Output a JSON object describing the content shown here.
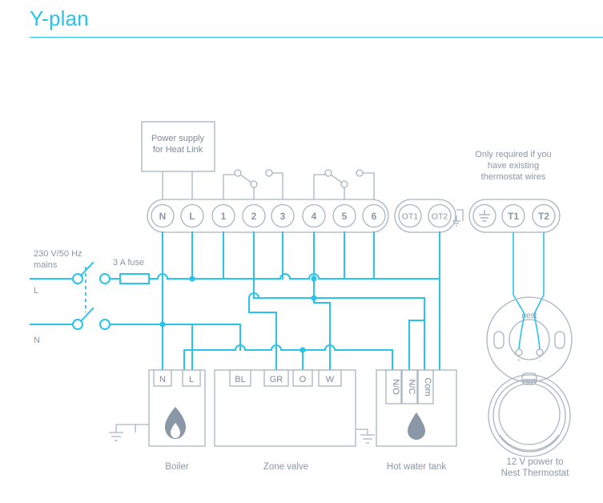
{
  "page": {
    "title": "Y-plan",
    "accent_color": "#29c4ea",
    "gray_color": "#8a97a6",
    "line_gray": "#a8b4c0"
  },
  "power_supply_box": {
    "line1": "Power supply",
    "line2": "for Heat Link"
  },
  "heat_link_terminals": {
    "group1": [
      "N",
      "L",
      "1",
      "2",
      "3",
      "4",
      "5",
      "6"
    ],
    "group2": [
      "OT1",
      "OT2"
    ],
    "group3": [
      "earth-symbol",
      "T1",
      "T2"
    ],
    "group3_labels": [
      "",
      "T1",
      "T2"
    ]
  },
  "notes": {
    "thermostat_wires": {
      "line1": "Only required if you",
      "line2": "have existing",
      "line3": "thermostat wires"
    },
    "nest_power": {
      "line1": "12 V power to",
      "line2": "Nest Thermostat"
    }
  },
  "mains": {
    "label_line1": "230 V/50 Hz",
    "label_line2": "mains",
    "live_label": "L",
    "neutral_label": "N",
    "fuse_label": "3 A fuse"
  },
  "devices": [
    {
      "id": "boiler",
      "caption": "Boiler",
      "terminals": [
        "N",
        "L"
      ],
      "icon": "flame-icon"
    },
    {
      "id": "zone-valve",
      "caption": "Zone valve",
      "terminals": [
        "BL",
        "GR",
        "O",
        "W"
      ],
      "icon": ""
    },
    {
      "id": "hot-water-tank",
      "caption": "Hot water tank",
      "terminals": [
        "N/O",
        "N/C",
        "Com"
      ],
      "icon": "water-drop-icon"
    }
  ],
  "nest": {
    "base_logo": "nest",
    "unit_logo": "nest"
  }
}
